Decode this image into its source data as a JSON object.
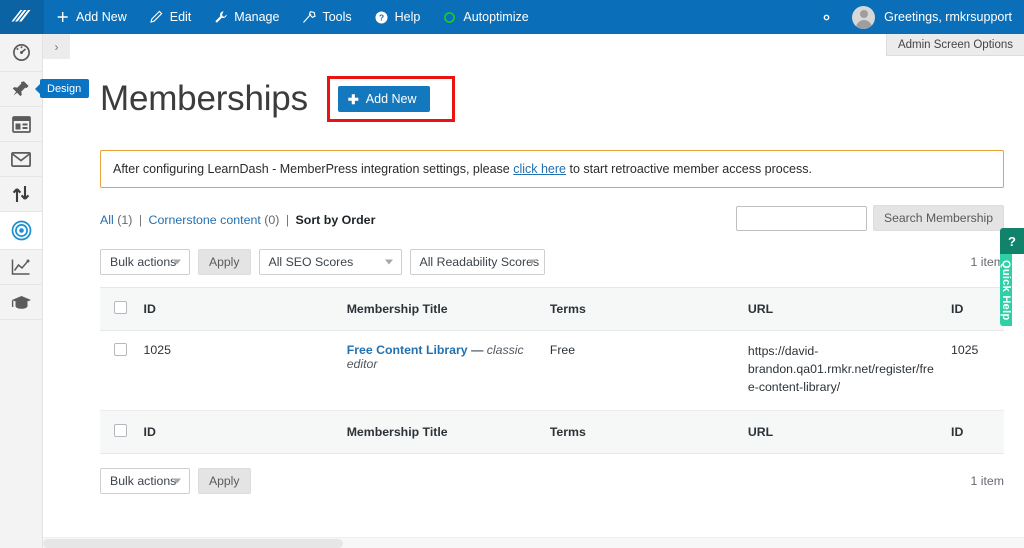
{
  "adminbar": {
    "logo_icon": "wordpress-slashes-logo",
    "items": [
      {
        "label": "Add New",
        "icon": "plus-icon"
      },
      {
        "label": "Edit",
        "icon": "pencil-icon"
      },
      {
        "label": "Manage",
        "icon": "wrench-icon"
      },
      {
        "label": "Tools",
        "icon": "tools-icon"
      },
      {
        "label": "Help",
        "icon": "question-circle-icon"
      },
      {
        "label": "Autoptimize",
        "icon": "circle-outline-icon"
      }
    ],
    "gear_icon": "gear-icon",
    "greeting": "Greetings, rmkrsupport",
    "avatar_icon": "user-avatar-icon"
  },
  "screen_meta": {
    "label": "Admin Screen Options"
  },
  "sidebar": {
    "collapse_icon": "chevron-right-icon",
    "tooltip": "Design",
    "items": [
      {
        "name": "dashboard",
        "icon": "gauge-icon",
        "active": false
      },
      {
        "name": "design",
        "icon": "pin-icon",
        "active": false
      },
      {
        "name": "pages",
        "icon": "layout-icon",
        "active": false
      },
      {
        "name": "mail",
        "icon": "envelope-icon",
        "active": false
      },
      {
        "name": "updates",
        "icon": "up-down-arrows-icon",
        "active": false
      },
      {
        "name": "memberships",
        "icon": "target-icon",
        "active": true
      },
      {
        "name": "analytics",
        "icon": "line-chart-icon",
        "active": false
      },
      {
        "name": "courses",
        "icon": "graduation-cap-icon",
        "active": false
      }
    ]
  },
  "page": {
    "title": "Memberships",
    "add_new_label": "Add New",
    "add_new_icon": "plus-icon",
    "highlight_color": "#e8140f",
    "accent_color": "#1478be"
  },
  "notice": {
    "text_before": "After configuring LearnDash - MemberPress integration settings, please ",
    "link_text": "click here",
    "text_after": " to start retroactive member access process.",
    "border_color": "#e8a33d"
  },
  "filters": {
    "all_label": "All",
    "all_count": "(1)",
    "sep1": "|",
    "cornerstone_label": "Cornerstone content",
    "cornerstone_count": "(0)",
    "sep2": "|",
    "sort_label": "Sort by Order"
  },
  "search": {
    "value": "",
    "placeholder": "",
    "button_label": "Search Membership"
  },
  "tablenav_top": {
    "bulk_actions_label": "Bulk actions",
    "apply_label": "Apply",
    "seo_scores_label": "All SEO Scores",
    "readability_label": "All Readability Scores",
    "item_count": "1 item"
  },
  "tablenav_bottom": {
    "bulk_actions_label": "Bulk actions",
    "apply_label": "Apply",
    "item_count": "1 item"
  },
  "table": {
    "headers": [
      "ID",
      "Membership Title",
      "Terms",
      "URL",
      "ID"
    ],
    "rows": [
      {
        "id": "1025",
        "title_link": "Free Content Library",
        "title_dash": "—",
        "title_editor": "classic editor",
        "terms": "Free",
        "url": "https://david-brandon.qa01.rmkr.net/register/free-content-library/",
        "id2": "1025"
      }
    ]
  },
  "quick_help": {
    "icon_label": "?",
    "label": "Quick Help",
    "top_color": "#12836b",
    "body_color": "#2fd0a5"
  }
}
